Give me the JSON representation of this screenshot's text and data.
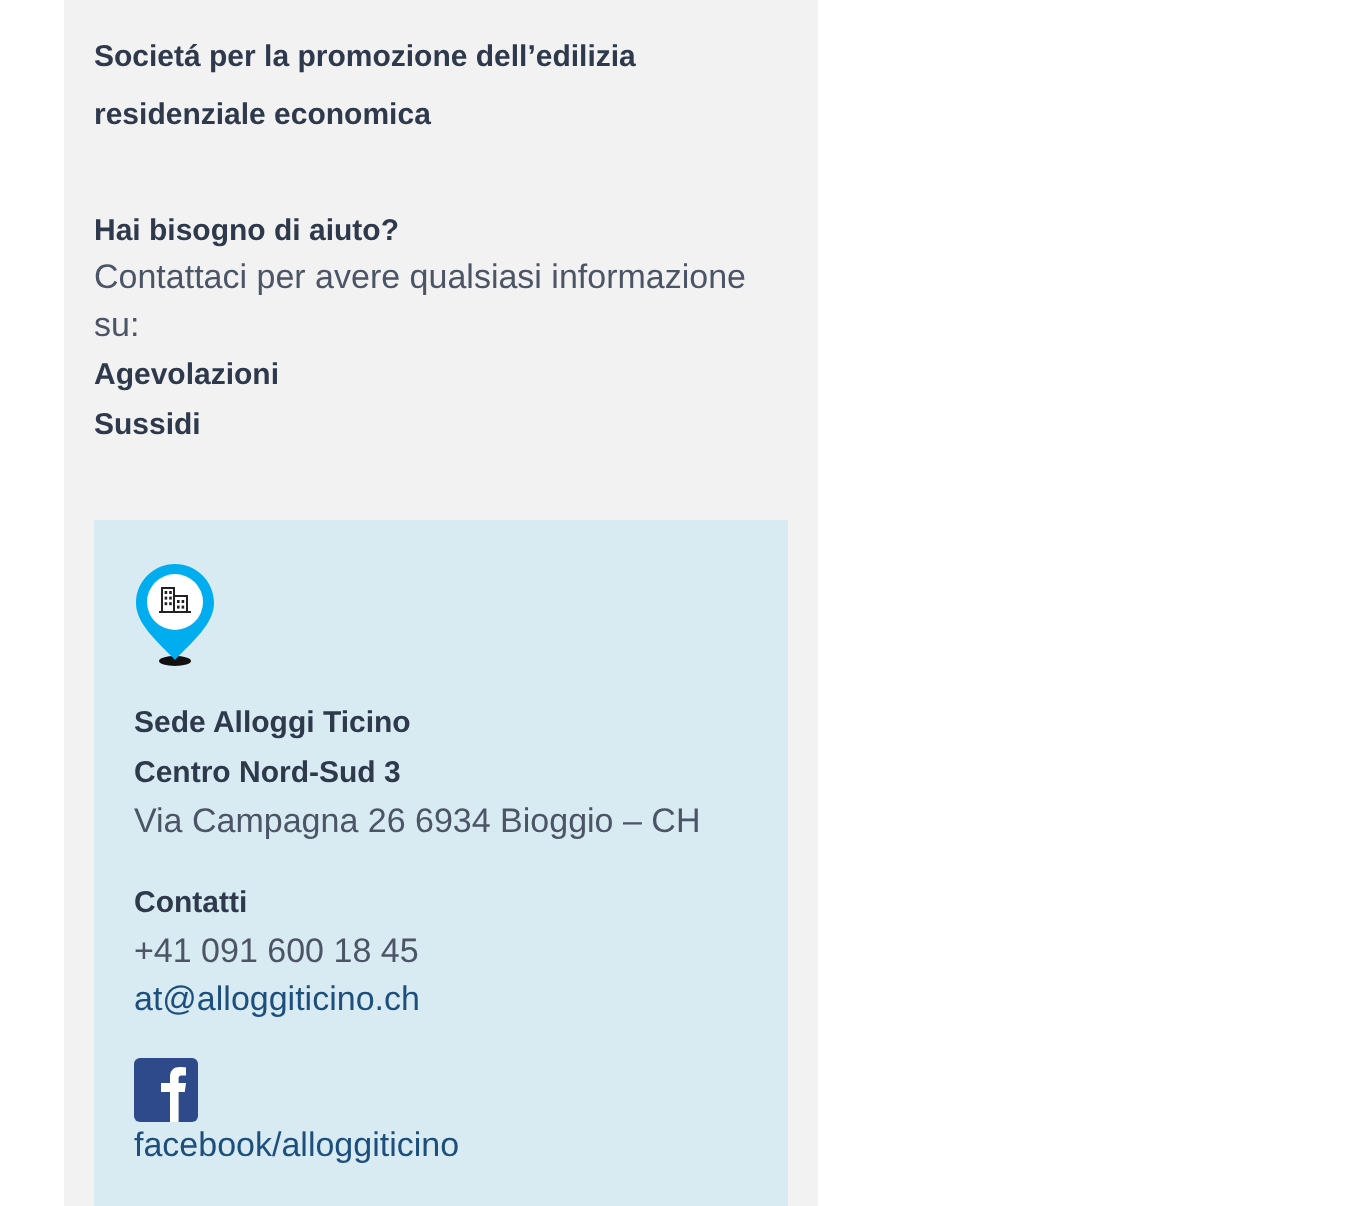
{
  "intro": {
    "text": "Societá per la promozione dell’edilizia residenziale economica"
  },
  "help": {
    "title": "Hai bisogno di aiuto?",
    "text": "Contattaci per avere qualsiasi informazione su:",
    "links": [
      "Agevolazioni",
      "Sussidi"
    ]
  },
  "office": {
    "name": "Sede Alloggi Ticino",
    "building": "Centro Nord-Sud 3",
    "address": "Via Campagna 26 6934 Bioggio – CH"
  },
  "contacts": {
    "title": "Contatti",
    "phone": "+41 091 600 18 45",
    "email": "at@alloggiticino.ch",
    "facebook": "facebook/alloggiticino"
  }
}
